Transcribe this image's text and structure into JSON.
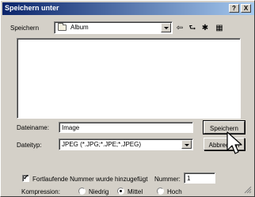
{
  "window": {
    "title": "Speichern unter"
  },
  "titlebar_buttons": {
    "help": "?",
    "close": "X"
  },
  "save_in": {
    "label": "Speichern",
    "folder": "Album"
  },
  "toolbar": {
    "back_icon": "⇦",
    "up_icon": "⮑",
    "newfolder_icon": "✱",
    "view_icon": "▦"
  },
  "filename": {
    "label": "Dateiname:",
    "value": "Image"
  },
  "filetype": {
    "label": "Dateityp:",
    "value": "JPEG (*.JPG;*.JPE;*.JPEG)"
  },
  "buttons": {
    "save": "Speichern",
    "cancel": "Abbrechen"
  },
  "options": {
    "sequential_label": "Fortlaufende Nummer wurde hinzugefügt",
    "number_label": "Nummer:",
    "number_value": "1"
  },
  "compression": {
    "label": "Kompression:",
    "low": "Niedrig",
    "medium": "Mittel",
    "high": "Hoch",
    "selected": "Mittel"
  }
}
